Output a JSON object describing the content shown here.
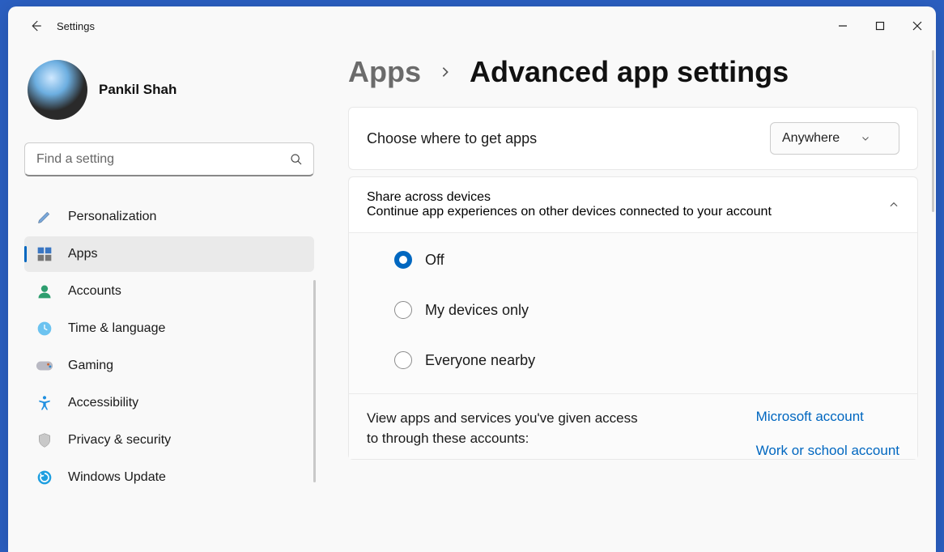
{
  "window": {
    "title": "Settings"
  },
  "user": {
    "name": "Pankil Shah"
  },
  "search": {
    "placeholder": "Find a setting"
  },
  "sidebar": {
    "items": [
      {
        "label": "Personalization",
        "icon": "brush-icon"
      },
      {
        "label": "Apps",
        "icon": "apps-icon",
        "selected": true
      },
      {
        "label": "Accounts",
        "icon": "person-icon"
      },
      {
        "label": "Time & language",
        "icon": "clock-globe-icon"
      },
      {
        "label": "Gaming",
        "icon": "gamepad-icon"
      },
      {
        "label": "Accessibility",
        "icon": "accessibility-icon"
      },
      {
        "label": "Privacy & security",
        "icon": "shield-icon"
      },
      {
        "label": "Windows Update",
        "icon": "update-icon"
      }
    ]
  },
  "breadcrumb": {
    "parent": "Apps",
    "current": "Advanced app settings"
  },
  "settings": {
    "where_label": "Choose where to get apps",
    "where_value": "Anywhere",
    "share": {
      "title": "Share across devices",
      "subtitle": "Continue app experiences on other devices connected to your account",
      "options": [
        {
          "label": "Off",
          "selected": true
        },
        {
          "label": "My devices only",
          "selected": false
        },
        {
          "label": "Everyone nearby",
          "selected": false
        }
      ]
    },
    "accounts_text": "View apps and services you've given access to through these accounts:",
    "account_links": [
      "Microsoft account",
      "Work or school account"
    ]
  }
}
